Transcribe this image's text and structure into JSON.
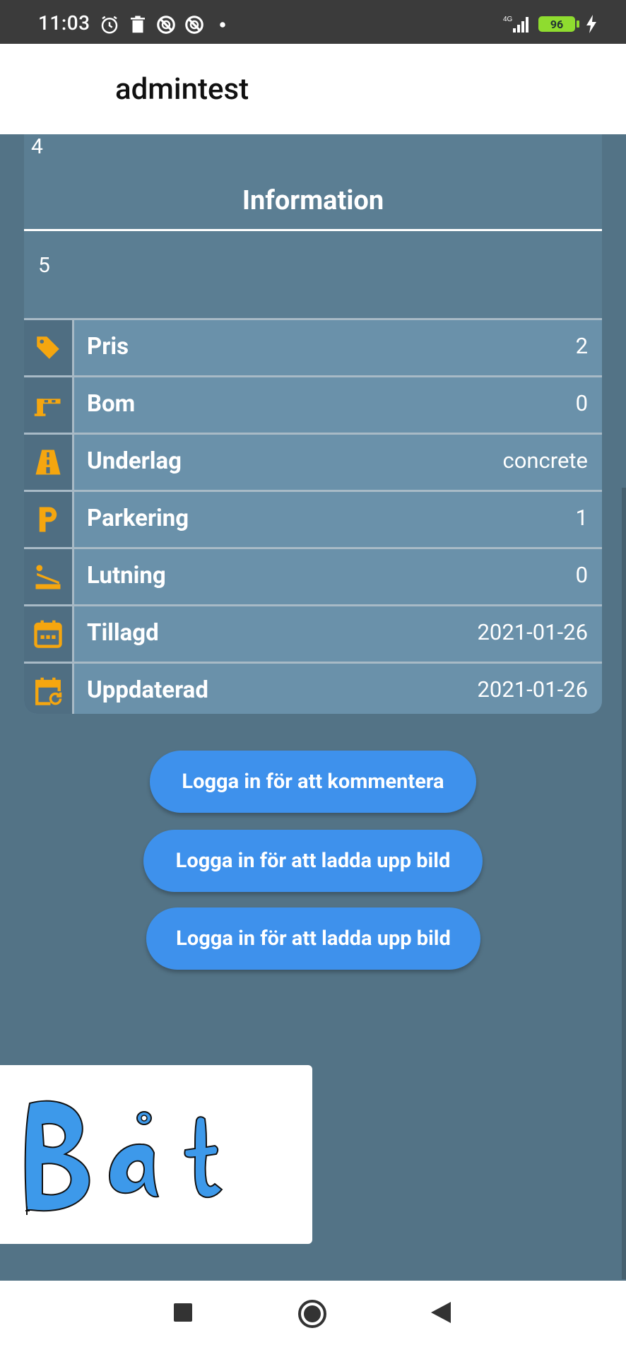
{
  "status_bar": {
    "time": "11:03",
    "network": "4G",
    "battery": "96"
  },
  "app_bar": {
    "title": "admintest"
  },
  "card": {
    "top_number": "4",
    "heading": "Information",
    "mid_number": "5",
    "rows": [
      {
        "label": "Pris",
        "value": "2",
        "icon": "price-tag-icon"
      },
      {
        "label": "Bom",
        "value": "0",
        "icon": "barrier-icon"
      },
      {
        "label": "Underlag",
        "value": "concrete",
        "icon": "road-icon"
      },
      {
        "label": "Parkering",
        "value": "1",
        "icon": "parking-icon"
      },
      {
        "label": "Lutning",
        "value": "0",
        "icon": "slope-icon"
      },
      {
        "label": "Tillagd",
        "value": "2021-01-26",
        "icon": "calendar-icon"
      },
      {
        "label": "Uppdaterad",
        "value": "2021-01-26",
        "icon": "calendar-refresh-icon"
      }
    ]
  },
  "buttons": {
    "comment": "Logga in för att kommentera",
    "upload1": "Logga in för att ladda upp bild",
    "upload2": "Logga in för att ladda upp bild"
  },
  "drawing": {
    "text": "Båt",
    "color": "#3d99ea"
  },
  "colors": {
    "accent": "#3e91ec",
    "icon": "#f5a60f",
    "background": "#537386"
  }
}
